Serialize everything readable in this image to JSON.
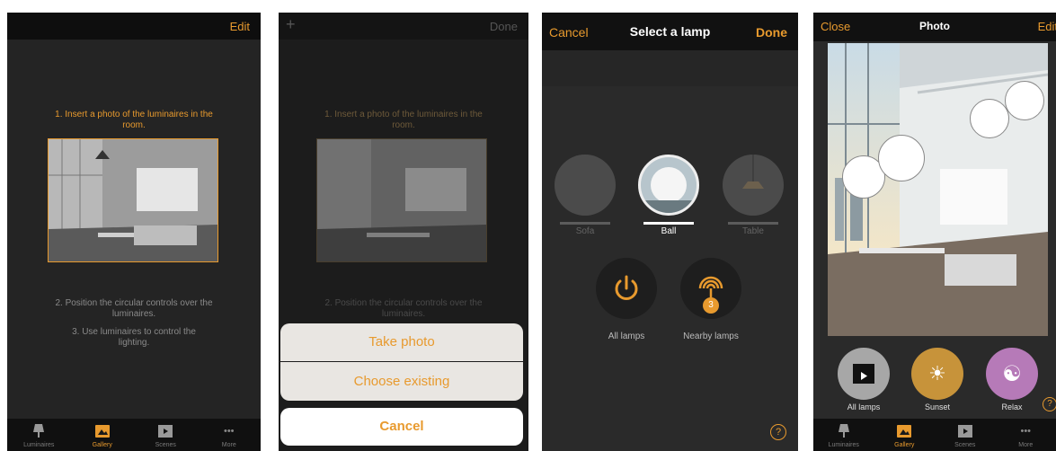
{
  "screen1": {
    "edit_label": "Edit",
    "step1": "1. Insert a photo of the luminaires in the room.",
    "step2": "2. Position the circular controls over the luminaires.",
    "step3": "3. Use luminaires to control the lighting."
  },
  "tabs": {
    "luminaires": "Luminaires",
    "gallery": "Gallery",
    "scenes": "Scenes",
    "more": "More"
  },
  "screen2": {
    "add_label": "+",
    "done_label": "Done",
    "step1": "1. Insert a photo of the luminaires in the room.",
    "step2": "2. Position the circular controls over the luminaires.",
    "take_photo": "Take photo",
    "choose_existing": "Choose existing",
    "cancel": "Cancel"
  },
  "screen3": {
    "cancel_label": "Cancel",
    "title": "Select a lamp",
    "done_label": "Done",
    "lamps": [
      "Sofa",
      "Ball",
      "Table"
    ],
    "all_lamps": "All lamps",
    "nearby_lamps": "Nearby lamps",
    "nearby_count": "3",
    "help": "?"
  },
  "screen4": {
    "close_label": "Close",
    "title": "Photo",
    "edit_label": "Edit",
    "scenes": [
      "All lamps",
      "Sunset",
      "Relax"
    ],
    "help": "?"
  },
  "colors": {
    "accent": "#e89a2e",
    "sunset": "#c7933a",
    "relax": "#b67ab8"
  }
}
